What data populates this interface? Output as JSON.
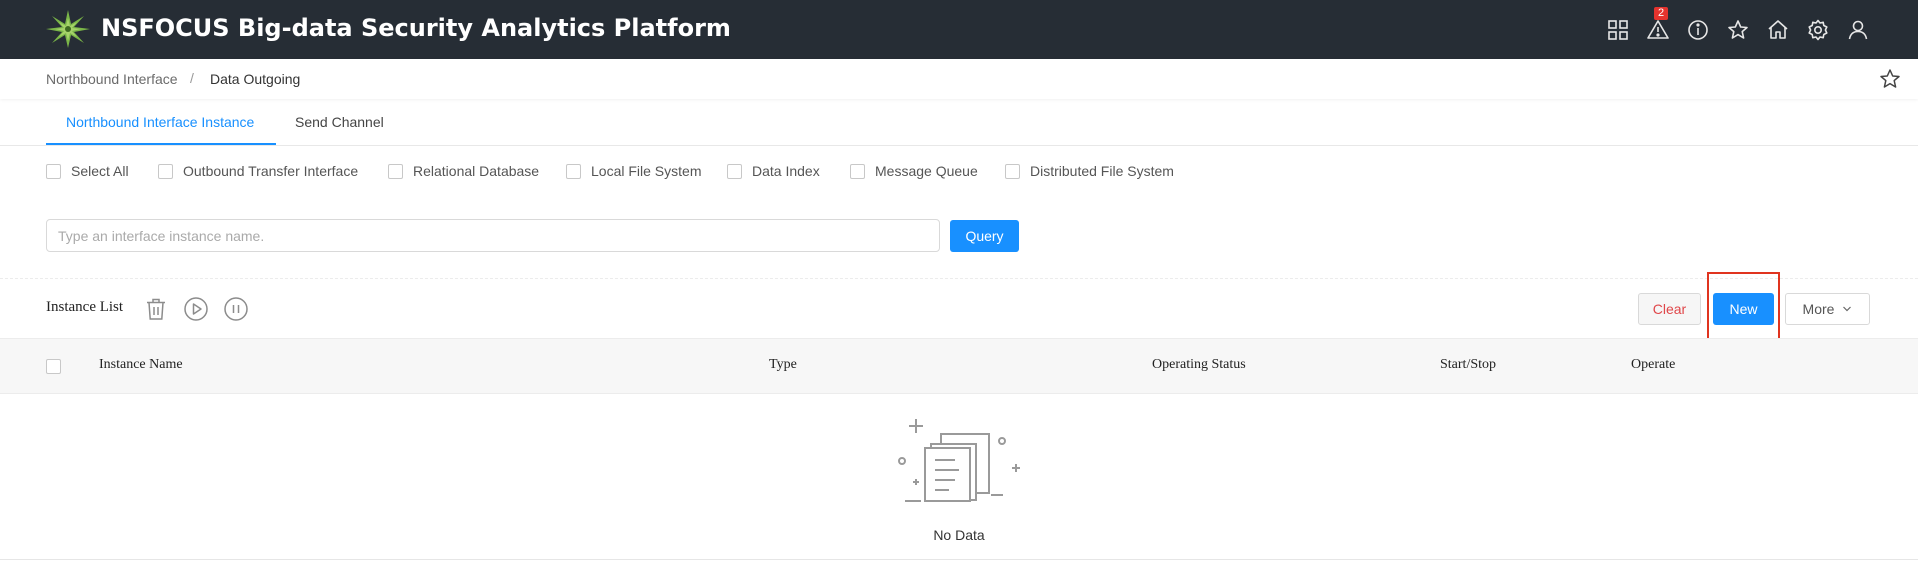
{
  "header": {
    "app_title": "NSFOCUS Big-data Security Analytics Platform",
    "alert_count": "2",
    "icons": [
      "grid-icon",
      "alert-icon",
      "info-icon",
      "star-icon",
      "home-icon",
      "gear-icon",
      "user-icon"
    ]
  },
  "breadcrumb": {
    "parent": "Northbound Interface",
    "separator": "/",
    "current": "Data Outgoing"
  },
  "tabs": [
    {
      "label": "Northbound Interface Instance",
      "active": true
    },
    {
      "label": "Send Channel",
      "active": false
    }
  ],
  "filters": [
    {
      "label": "Select All",
      "checked": false
    },
    {
      "label": "Outbound Transfer Interface",
      "checked": false
    },
    {
      "label": "Relational Database",
      "checked": false
    },
    {
      "label": "Local File System",
      "checked": false
    },
    {
      "label": "Data Index",
      "checked": false
    },
    {
      "label": "Message Queue",
      "checked": false
    },
    {
      "label": "Distributed File System",
      "checked": false
    }
  ],
  "search": {
    "placeholder": "Type an interface instance name.",
    "value": "",
    "query_label": "Query"
  },
  "instance_list": {
    "title": "Instance List",
    "clear_label": "Clear",
    "new_label": "New",
    "more_label": "More"
  },
  "table": {
    "columns": [
      "Instance Name",
      "Type",
      "Operating Status",
      "Start/Stop",
      "Operate"
    ],
    "rows": [],
    "empty_text": "No Data"
  },
  "colors": {
    "header_bg": "#262d35",
    "primary": "#1890ff",
    "danger": "#e0474a",
    "highlight": "#e0341f"
  }
}
